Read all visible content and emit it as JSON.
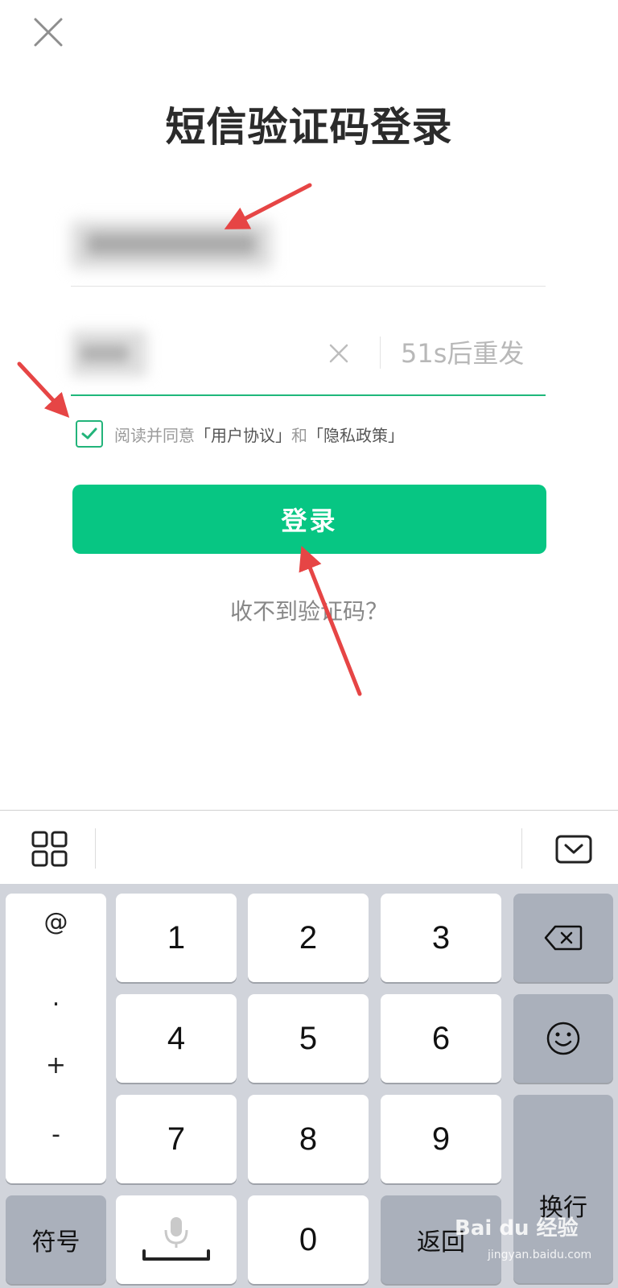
{
  "header": {
    "title": "短信验证码登录"
  },
  "form": {
    "code_resend": "51s后重发",
    "agreement_prefix": "阅读并同意",
    "user_agreement": "「用户协议」",
    "agreement_and": "和",
    "privacy_policy": "「隐私政策」",
    "agreement_checked": true,
    "login_button": "登录",
    "no_code_link": "收不到验证码？"
  },
  "colors": {
    "accent": "#07c683",
    "annotation_arrow": "#e64545"
  },
  "toolbar": {
    "left_icon": "grid-icon",
    "right_icon": "keyboard-hide-icon"
  },
  "keyboard": {
    "symbols": [
      "@",
      ".",
      "+",
      "-"
    ],
    "keys": [
      "1",
      "2",
      "3",
      "4",
      "5",
      "6",
      "7",
      "8",
      "9",
      "0"
    ],
    "symbols_key": "符号",
    "return_key": "返回",
    "newline_key": "换行",
    "delete_icon": "backspace-icon",
    "emoji_icon": "emoji-icon",
    "voice_icon": "microphone-icon"
  },
  "watermark": {
    "brand": "Bai du 经验",
    "url": "jingyan.baidu.com"
  }
}
